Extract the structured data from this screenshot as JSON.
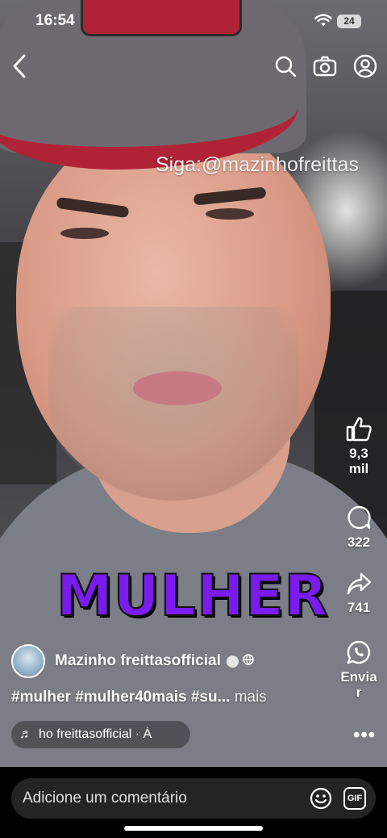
{
  "status_bar": {
    "time": "16:54",
    "battery": "24"
  },
  "video": {
    "overlay_handle": "Siga:@mazinhofreittas",
    "caption_word": "MULHER"
  },
  "actions": {
    "likes": "9,3\nmil",
    "likes_line1": "9,3",
    "likes_line2": "mil",
    "comments": "322",
    "shares": "741",
    "send_line1": "Envia",
    "send_line2": "r"
  },
  "post": {
    "author": "Mazinho freittasofficial",
    "hashtags": "#mulher  #mulher40mais #su...",
    "more_label": "mais",
    "music_track": "ho freittasofficial · Á"
  },
  "comment_bar": {
    "placeholder": "Adicione um comentário",
    "gif_label": "GIF"
  },
  "colors": {
    "caption_purple": "#7a1cf0",
    "cap_red": "#b02336",
    "comment_box_bg": "#242424"
  },
  "icons": [
    "back-icon",
    "search-icon",
    "camera-icon",
    "profile-icon",
    "like-icon",
    "comment-icon",
    "share-icon",
    "whatsapp-icon",
    "music-note-icon",
    "more-icon",
    "emoji-icon",
    "gif-icon",
    "wifi-icon",
    "verified-icon",
    "globe-icon"
  ]
}
